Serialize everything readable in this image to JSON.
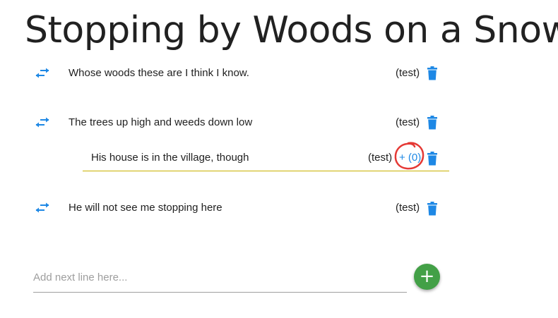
{
  "poem": {
    "title": "Stopping by Woods on a Snowy"
  },
  "lines": [
    {
      "text": "Whose woods these are I think I know.",
      "author": "(test)"
    },
    {
      "text": "The trees up high and weeds down low",
      "author": "(test)"
    },
    {
      "text": "He will not see me stopping here",
      "author": "(test)"
    }
  ],
  "child_line": {
    "text": "His house is in the village, though",
    "author": "(test)",
    "plus_label": "+ (0)"
  },
  "new_line": {
    "placeholder": "Add next line here..."
  },
  "add_button": {
    "label": "+"
  },
  "colors": {
    "accent_blue": "#1e88e5",
    "fab_green": "#43a047",
    "annotation_red": "#e53935"
  }
}
